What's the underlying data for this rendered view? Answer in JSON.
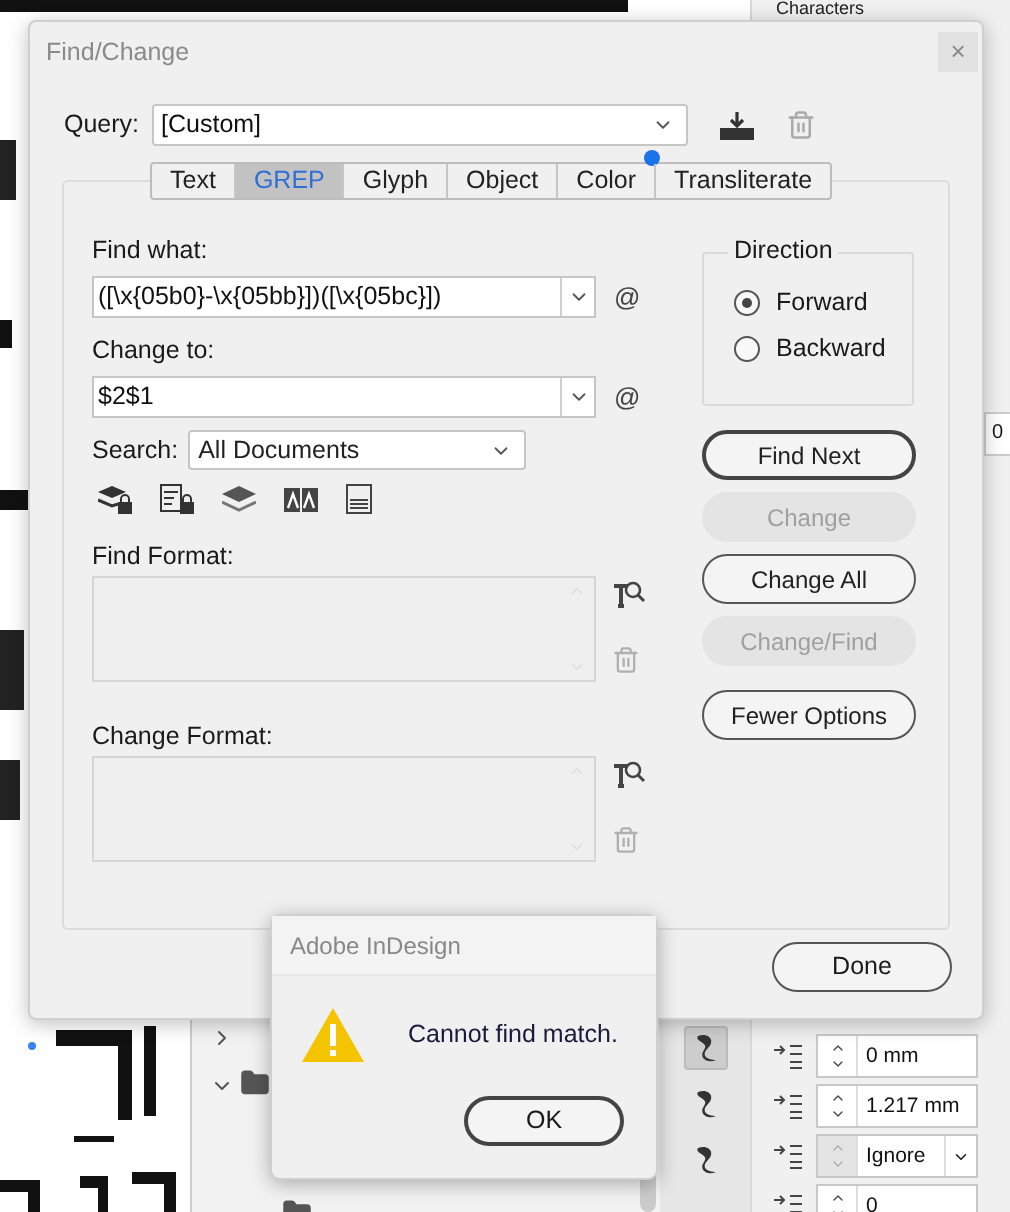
{
  "background": {
    "panel_title": "Characters",
    "side_field": "0",
    "tool_icons": [
      {
        "selected": true
      },
      {
        "selected": false
      },
      {
        "selected": false
      }
    ],
    "fields": [
      {
        "kind": "spinner",
        "value": "0 mm",
        "disabled_stepper": false
      },
      {
        "kind": "spinner",
        "value": "1.217 mm",
        "disabled_stepper": false
      },
      {
        "kind": "dropdown",
        "value": "Ignore",
        "disabled_stepper": true
      },
      {
        "kind": "spinner",
        "value": "0",
        "disabled_stepper": false
      }
    ]
  },
  "dialog": {
    "title": "Find/Change",
    "close": "×",
    "query": {
      "label": "Query:",
      "value": "[Custom]"
    },
    "tabs": [
      {
        "label": "Text",
        "selected": false,
        "dot": false
      },
      {
        "label": "GREP",
        "selected": true,
        "dot": false
      },
      {
        "label": "Glyph",
        "selected": false,
        "dot": false
      },
      {
        "label": "Object",
        "selected": false,
        "dot": false
      },
      {
        "label": "Color",
        "selected": false,
        "dot": true
      },
      {
        "label": "Transliterate",
        "selected": false,
        "dot": false
      }
    ],
    "find_what": {
      "label": "Find what:",
      "value": "([\\x{05b0}-\\x{05bb}])([\\x{05bc}])",
      "special": "@"
    },
    "change_to": {
      "label": "Change to:",
      "value": "$2$1",
      "special": "@"
    },
    "search": {
      "label": "Search:",
      "value": "All Documents"
    },
    "find_format": {
      "label": "Find Format:"
    },
    "change_format": {
      "label": "Change Format:"
    },
    "direction": {
      "title": "Direction",
      "options": [
        {
          "label": "Forward",
          "selected": true
        },
        {
          "label": "Backward",
          "selected": false
        }
      ]
    },
    "buttons": [
      {
        "label": "Find Next",
        "default": true,
        "disabled": false
      },
      {
        "label": "Change",
        "default": false,
        "disabled": true
      },
      {
        "label": "Change All",
        "default": false,
        "disabled": false
      },
      {
        "label": "Change/Find",
        "default": false,
        "disabled": true
      },
      {
        "label": "Fewer Options",
        "default": false,
        "disabled": false
      }
    ],
    "done": "Done"
  },
  "alert": {
    "title": "Adobe InDesign",
    "message": "Cannot find match.",
    "ok": "OK"
  }
}
